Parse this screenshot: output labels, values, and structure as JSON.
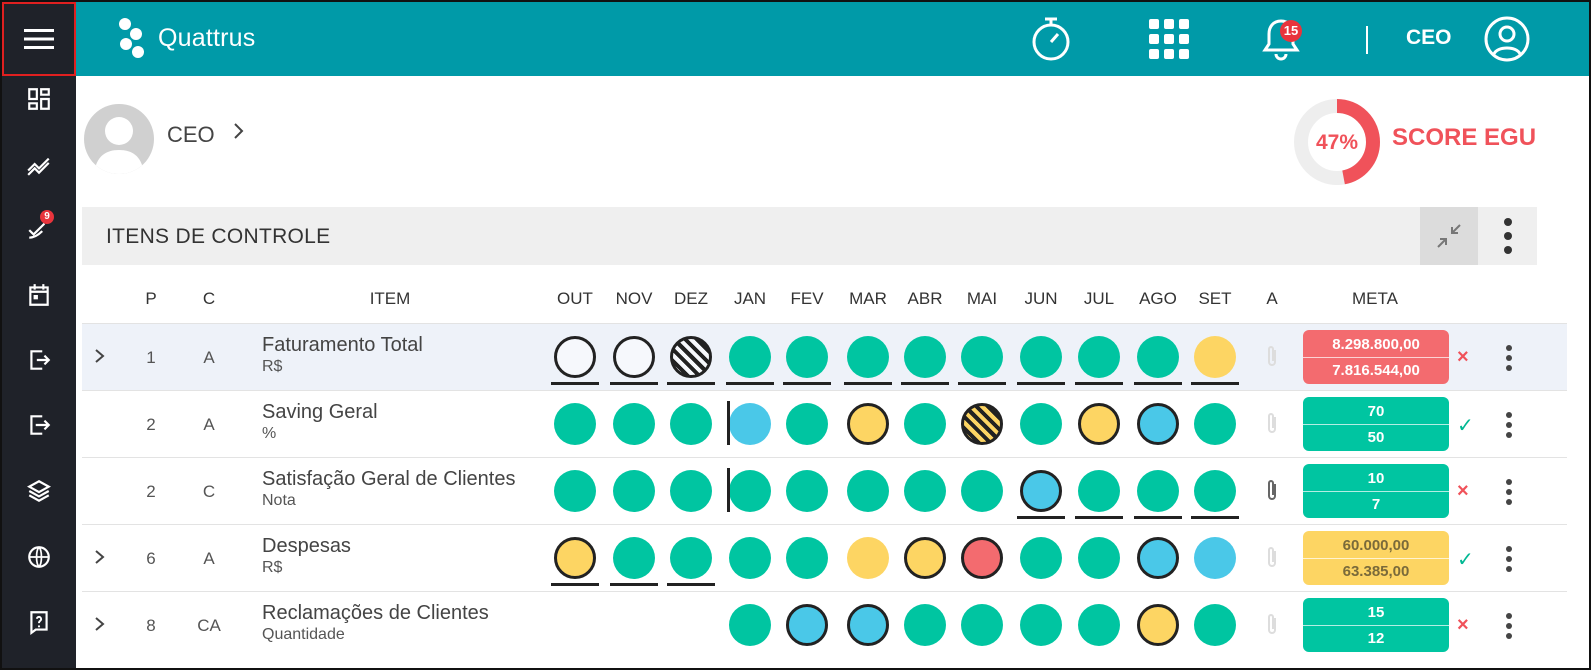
{
  "app": {
    "name": "Quattrus",
    "notifications_count": "15",
    "user_label": "CEO"
  },
  "sidebar": {
    "approvals_badge": "9",
    "items": [
      "menu",
      "dashboard",
      "charts",
      "approvals",
      "calendar",
      "import",
      "export",
      "layers",
      "globe",
      "help"
    ]
  },
  "profile": {
    "name": "CEO",
    "score_percent": "47%",
    "score_value": 47,
    "score_label": "SCORE EGU"
  },
  "section": {
    "title": "ITENS DE CONTROLE"
  },
  "table": {
    "columns": {
      "p": "P",
      "c": "C",
      "item": "ITEM",
      "months": [
        "OUT",
        "NOV",
        "DEZ",
        "JAN",
        "FEV",
        "MAR",
        "ABR",
        "MAI",
        "JUN",
        "JUL",
        "AGO",
        "SET"
      ],
      "a": "A",
      "meta": "META"
    },
    "rows": [
      {
        "expandable": true,
        "p": "1",
        "c": "A",
        "name": "Faturamento Total",
        "unit": "R$",
        "months": [
          "w",
          "w",
          "hw",
          "g",
          "g",
          "g",
          "g",
          "g",
          "g",
          "g",
          "g",
          "y"
        ],
        "underlined": [
          true,
          true,
          true,
          true,
          true,
          true,
          true,
          true,
          true,
          true,
          true,
          true
        ],
        "year_break": false,
        "attachment": false,
        "meta_top": "8.298.800,00",
        "meta_bottom": "7.816.544,00",
        "meta_color": "red",
        "status": "×",
        "status_type": "x"
      },
      {
        "expandable": false,
        "p": "2",
        "c": "A",
        "name": "Saving Geral",
        "unit": "%",
        "months": [
          "g",
          "g",
          "g",
          "b",
          "g",
          "yb",
          "g",
          "hy",
          "g",
          "yb",
          "bb",
          "g"
        ],
        "underlined": [
          false,
          false,
          false,
          false,
          false,
          false,
          false,
          false,
          false,
          false,
          false,
          false
        ],
        "year_break": true,
        "attachment": false,
        "meta_top": "70",
        "meta_bottom": "50",
        "meta_color": "green",
        "status": "✓",
        "status_type": "ok"
      },
      {
        "expandable": false,
        "p": "2",
        "c": "C",
        "name": "Satisfação Geral de Clientes",
        "unit": "Nota",
        "months": [
          "g",
          "g",
          "g",
          "g",
          "g",
          "g",
          "g",
          "g",
          "bb",
          "g",
          "g",
          "g"
        ],
        "underlined": [
          false,
          false,
          false,
          false,
          false,
          false,
          false,
          false,
          true,
          true,
          true,
          true
        ],
        "year_break": true,
        "attachment": true,
        "meta_top": "10",
        "meta_bottom": "7",
        "meta_color": "green",
        "status": "×",
        "status_type": "x"
      },
      {
        "expandable": true,
        "p": "6",
        "c": "A",
        "name": "Despesas",
        "unit": "R$",
        "months": [
          "yb",
          "g",
          "g",
          "g",
          "g",
          "y",
          "yb",
          "rb",
          "g",
          "g",
          "bb",
          "b"
        ],
        "underlined": [
          true,
          true,
          true,
          false,
          false,
          false,
          false,
          false,
          false,
          false,
          false,
          false
        ],
        "year_break": false,
        "attachment": false,
        "meta_top": "60.000,00",
        "meta_bottom": "63.385,00",
        "meta_color": "yellow",
        "status": "✓",
        "status_type": "ok"
      },
      {
        "expandable": true,
        "p": "8",
        "c": "CA",
        "name": "Reclamações de Clientes",
        "unit": "Quantidade",
        "months": [
          "",
          "",
          "",
          "g",
          "bb",
          "bb",
          "g",
          "g",
          "g",
          "g",
          "yb",
          "g"
        ],
        "underlined": [
          false,
          false,
          false,
          false,
          false,
          false,
          false,
          false,
          false,
          false,
          false,
          false
        ],
        "year_break": false,
        "attachment": false,
        "meta_top": "15",
        "meta_bottom": "12",
        "meta_color": "green",
        "status": "×",
        "status_type": "x"
      }
    ]
  },
  "colors": {
    "header_bg": "#009aa8",
    "sidebar_bg": "#1f2229",
    "green": "#00c5a1",
    "blue": "#4ac8e8",
    "yellow": "#fdd563",
    "red": "#f36b6f",
    "score": "#f0525a"
  }
}
